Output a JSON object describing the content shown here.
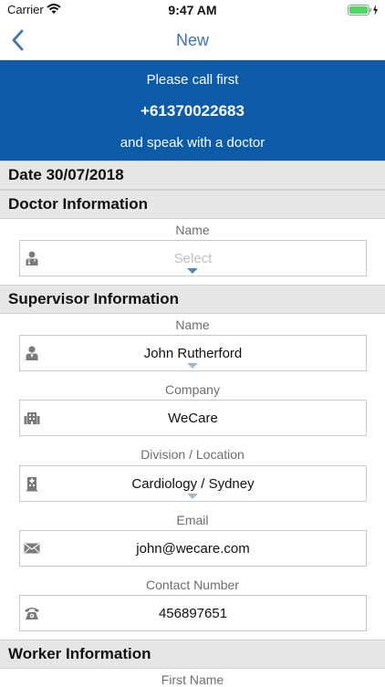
{
  "status_bar": {
    "carrier": "Carrier",
    "time": "9:47 AM"
  },
  "nav": {
    "title": "New"
  },
  "banner": {
    "line1": "Please call first",
    "phone": "+61370022683",
    "line3": "and speak with a doctor",
    "background": "#0b5ba6"
  },
  "date_header": "Date 30/07/2018",
  "doctor": {
    "header": "Doctor Information",
    "name_label": "Name",
    "name_placeholder": "Select"
  },
  "supervisor": {
    "header": "Supervisor Information",
    "name_label": "Name",
    "name_value": "John Rutherford",
    "company_label": "Company",
    "company_value": "WeCare",
    "division_label": "Division / Location",
    "division_value": "Cardiology / Sydney",
    "email_label": "Email",
    "email_value": "john@wecare.com",
    "contact_label": "Contact Number",
    "contact_value": "456897651"
  },
  "worker": {
    "header": "Worker Information",
    "first_name_label": "First Name"
  },
  "colors": {
    "accent": "#3f74a8",
    "section_bg": "#e6e6e6"
  }
}
